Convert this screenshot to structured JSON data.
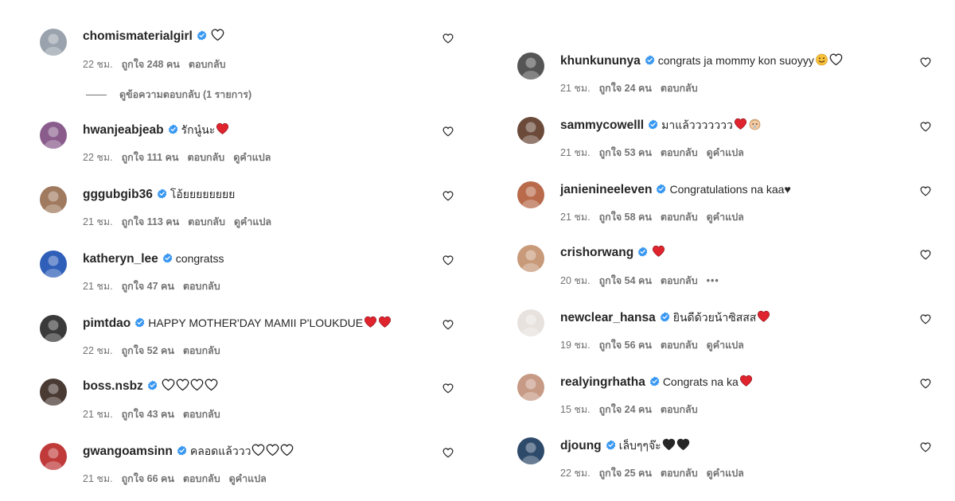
{
  "labels": {
    "reply": "ตอบกลับ",
    "translate": "ดูคำแปล",
    "likes_prefix": "ถูกใจ",
    "likes_suffix": "คน",
    "view_replies": "ดูข้อความตอบกลับ (1 รายการ)",
    "more": "•••"
  },
  "left": [
    {
      "username": "chomismaterialgirl",
      "text": "",
      "emoji": [
        "white-heart"
      ],
      "time": "22 ชม.",
      "likes": "ถูกใจ 248 คน",
      "reply": "ตอบกลับ",
      "translate": "",
      "view_replies": "ดูข้อความตอบกลับ (1 รายการ)",
      "avatar_color": "#9aa3ad"
    },
    {
      "username": "hwanjeabjeab",
      "text": "รักนู๋นะ",
      "emoji": [
        "red-heart"
      ],
      "time": "22 ชม.",
      "likes": "ถูกใจ 111 คน",
      "reply": "ตอบกลับ",
      "translate": "ดูคำแปล",
      "avatar_color": "#8a5c8c"
    },
    {
      "username": "gggubgib36",
      "text": "โอ้ยยยยยยยย",
      "emoji": [],
      "time": "21 ชม.",
      "likes": "ถูกใจ 113 คน",
      "reply": "ตอบกลับ",
      "translate": "ดูคำแปล",
      "avatar_color": "#a07a5e"
    },
    {
      "username": "katheryn_lee",
      "text": "congratss",
      "emoji": [],
      "time": "21 ชม.",
      "likes": "ถูกใจ 47 คน",
      "reply": "ตอบกลับ",
      "translate": "",
      "avatar_color": "#2f5fb8"
    },
    {
      "username": "pimtdao",
      "text": "HAPPY MOTHER'DAY MAMII P'LOUKDUE",
      "emoji": [
        "red-heart",
        "red-heart"
      ],
      "time": "22 ชม.",
      "likes": "ถูกใจ 52 คน",
      "reply": "ตอบกลับ",
      "translate": "",
      "avatar_color": "#3a3a3a"
    },
    {
      "username": "boss.nsbz",
      "text": "",
      "emoji": [
        "white-heart",
        "white-heart",
        "white-heart",
        "white-heart"
      ],
      "time": "21 ชม.",
      "likes": "ถูกใจ 43 คน",
      "reply": "ตอบกลับ",
      "translate": "",
      "avatar_color": "#4a3a34"
    },
    {
      "username": "gwangoamsinn",
      "text": "คลอดแล้ววว",
      "emoji": [
        "white-heart",
        "white-heart",
        "white-heart"
      ],
      "time": "21 ชม.",
      "likes": "ถูกใจ 66 คน",
      "reply": "ตอบกลับ",
      "translate": "ดูคำแปล",
      "avatar_color": "#c03a3a"
    }
  ],
  "right": [
    {
      "username": "khunkununya",
      "text": "congrats ja mommy kon suoyyy",
      "emoji": [
        "smile",
        "white-heart"
      ],
      "time": "21 ชม.",
      "likes": "ถูกใจ 24 คน",
      "reply": "ตอบกลับ",
      "translate": "",
      "more": "",
      "avatar_color": "#555555"
    },
    {
      "username": "sammycowelll",
      "text": "มาแล้ววววววว",
      "emoji": [
        "red-heart",
        "baby"
      ],
      "time": "21 ชม.",
      "likes": "ถูกใจ 53 คน",
      "reply": "ตอบกลับ",
      "translate": "ดูคำแปล",
      "more": "",
      "avatar_color": "#6b4a3a"
    },
    {
      "username": "janienineeleven",
      "text": "Congratulations na kaa♥",
      "emoji": [],
      "time": "21 ชม.",
      "likes": "ถูกใจ 58 คน",
      "reply": "ตอบกลับ",
      "translate": "ดูคำแปล",
      "more": "",
      "avatar_color": "#b86a4a"
    },
    {
      "username": "crishorwang",
      "text": "",
      "emoji": [
        "red-heart"
      ],
      "time": "20 ชม.",
      "likes": "ถูกใจ 54 คน",
      "reply": "ตอบกลับ",
      "translate": "",
      "more": "•••",
      "avatar_color": "#c89a7a"
    },
    {
      "username": "newclear_hansa",
      "text": "ยินดีด้วยน้าซิสสส",
      "emoji": [
        "red-heart"
      ],
      "time": "19 ชม.",
      "likes": "ถูกใจ 56 คน",
      "reply": "ตอบกลับ",
      "translate": "ดูคำแปล",
      "more": "",
      "avatar_color": "#e8e2de"
    },
    {
      "username": "realyingrhatha",
      "text": "Congrats na ka",
      "emoji": [
        "red-heart"
      ],
      "time": "15 ชม.",
      "likes": "ถูกใจ 24 คน",
      "reply": "ตอบกลับ",
      "translate": "",
      "more": "",
      "avatar_color": "#c79a86"
    },
    {
      "username": "djoung",
      "text": "เล็บๆๆจ๊ะ",
      "emoji": [
        "black-heart",
        "black-heart"
      ],
      "time": "22 ชม.",
      "likes": "ถูกใจ 25 คน",
      "reply": "ตอบกลับ",
      "translate": "ดูคำแปล",
      "more": "",
      "avatar_color": "#2e4a6a"
    }
  ],
  "colors": {
    "verified": "#3897f0",
    "red_heart": "#e0242e",
    "meta": "#737373",
    "text": "#262626"
  }
}
